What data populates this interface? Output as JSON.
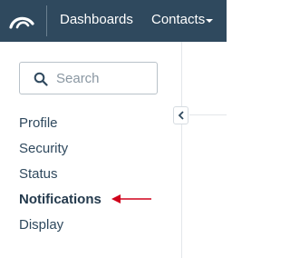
{
  "topbar": {
    "logo_icon": "hubspot-sprocket-logo",
    "nav": [
      {
        "label": "Dashboards"
      },
      {
        "label": "Contacts"
      }
    ],
    "background": "#2f495e"
  },
  "sidebar": {
    "search": {
      "placeholder": "Search",
      "value": ""
    },
    "items": [
      {
        "label": "Profile",
        "active": false
      },
      {
        "label": "Security",
        "active": false
      },
      {
        "label": "Status",
        "active": false
      },
      {
        "label": "Notifications",
        "active": true
      },
      {
        "label": "Display",
        "active": false
      }
    ],
    "collapse_icon": "chevron-left-icon"
  },
  "annotation": {
    "icon": "arrow-left-icon",
    "color": "#d0021b"
  }
}
